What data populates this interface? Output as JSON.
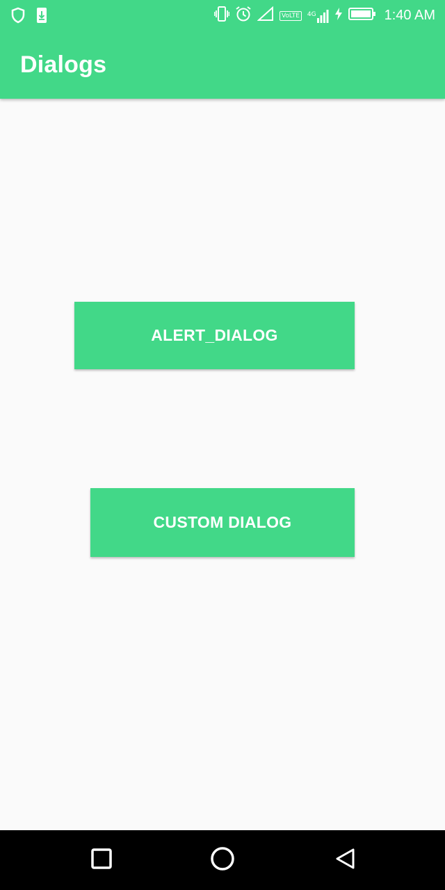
{
  "status_bar": {
    "time": "1:40 AM",
    "volte_label": "VoLTE",
    "network_label": "4G",
    "icons": [
      "shield-icon",
      "download-icon",
      "vibrate-icon",
      "alarm-icon",
      "signal-empty-icon",
      "volte-icon",
      "cell-signal-icon",
      "charging-icon",
      "battery-icon"
    ]
  },
  "app_bar": {
    "title": "Dialogs",
    "color": "#42d888"
  },
  "main": {
    "alert_button_label": "ALERT_DIALOG",
    "custom_button_label": "CUSTOM DIALOG"
  },
  "nav_bar": {
    "icons": [
      "recents-icon",
      "home-icon",
      "back-icon"
    ]
  }
}
